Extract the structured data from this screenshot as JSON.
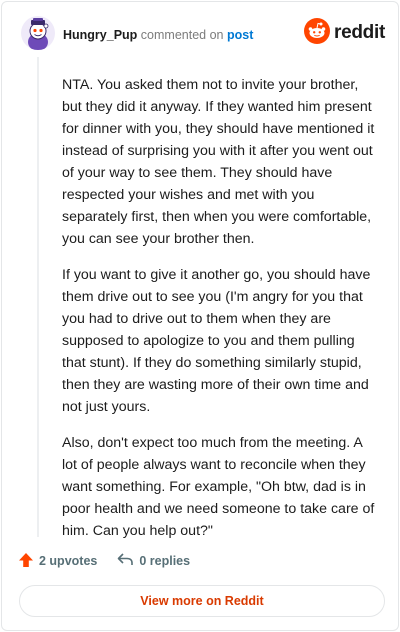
{
  "header": {
    "username": "Hungry_Pup",
    "action_text": "commented on",
    "post_link": "post",
    "brand": "reddit"
  },
  "comment": {
    "paragraphs": [
      "NTA. You asked them not to invite your brother, but they did it anyway. If they wanted him present for dinner with you, they should have mentioned it instead of surprising you with it after you went out of your way to see them. They should have respected your wishes and met with you separately first, then when you were comfortable, you can see your brother then.",
      "If you want to give it another go, you should have them drive out to see you (I'm angry for you that you had to drive out to them when they are supposed to apologize to you and them pulling that stunt). If they do something similarly stupid, then they are wasting more of their own time and not just yours.",
      "Also, don't expect too much from the meeting. A lot of people always want to reconcile when they want something. For example, \"Oh btw, dad is in poor health and we need someone to take care of him. Can you help out?\""
    ]
  },
  "actions": {
    "upvotes": "2 upvotes",
    "replies": "0 replies"
  },
  "footer": {
    "view_more": "View more on Reddit"
  },
  "colors": {
    "accent": "#ff4500",
    "link": "#0079d3",
    "view_more_text": "#d93a00"
  },
  "icons": {
    "avatar": "snoo-avatar-icon",
    "brand": "reddit-logo-icon",
    "upvote": "upvote-arrow-icon",
    "reply": "reply-arrow-icon"
  }
}
